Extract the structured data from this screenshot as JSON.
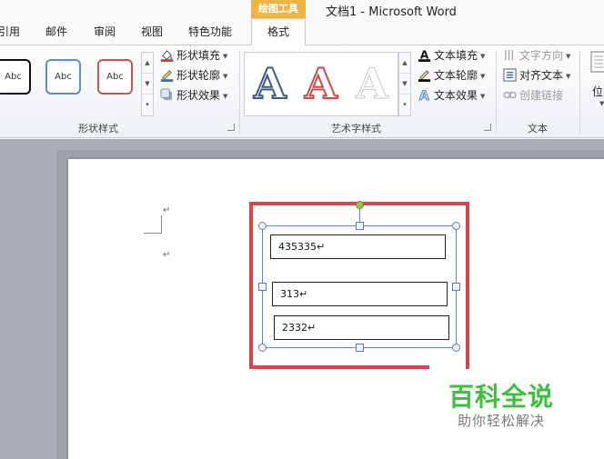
{
  "window": {
    "title": "文档1 - Microsoft Word"
  },
  "menu_tabs": [
    "引用",
    "邮件",
    "审阅",
    "视图",
    "特色功能"
  ],
  "context_tab": {
    "group_label": "绘图工具",
    "tab_label": "格式"
  },
  "ribbon": {
    "shape_styles": {
      "thumbnails": [
        "Abc",
        "Abc",
        "Abc"
      ],
      "fill": "形状填充",
      "outline": "形状轮廓",
      "effects": "形状效果",
      "group_label": "形状样式"
    },
    "word_art": {
      "letters": [
        "A",
        "A",
        "A"
      ],
      "text_fill": "文本填充",
      "text_outline": "文本轮廓",
      "text_effects": "文本效果",
      "group_label": "艺术字样式"
    },
    "text_group": {
      "direction": "文字方向",
      "align": "对齐文本",
      "link": "创建链接",
      "group_label": "文本"
    },
    "position": {
      "label": "位"
    }
  },
  "document": {
    "paragraph_mark": "↵",
    "textboxes": [
      "435335↵",
      "313↵",
      "2332↵"
    ]
  },
  "watermark": {
    "title": "百科全说",
    "subtitle": "助你轻松解决"
  },
  "colors": {
    "accent_red": "#d9434a",
    "context_orange": "#f0b444",
    "watermark_green": "#3cbf3a"
  }
}
